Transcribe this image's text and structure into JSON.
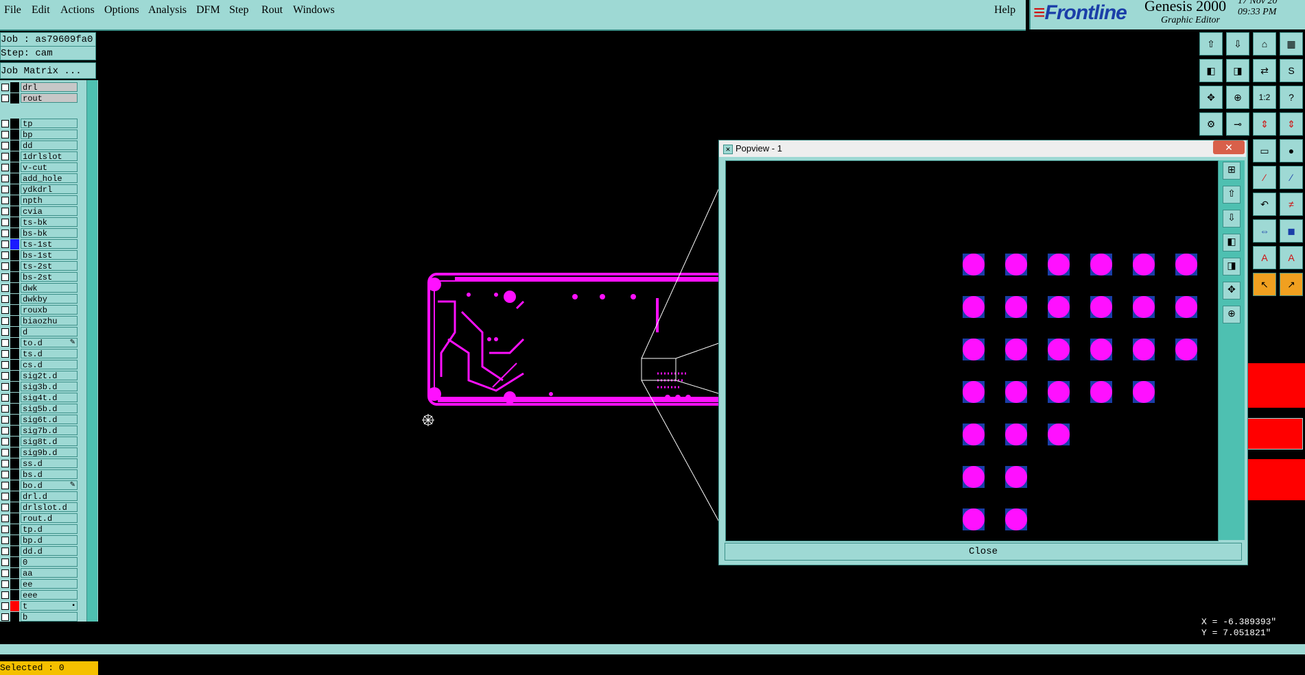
{
  "menu": {
    "items": [
      "File",
      "Edit",
      "Actions",
      "Options",
      "Analysis",
      "DFM",
      "Step",
      "Rout",
      "Windows"
    ],
    "help": "Help"
  },
  "brand": {
    "logo": "Frontline",
    "title": "Genesis 2000",
    "subtitle": "Graphic Editor",
    "date": "17 Nov 20",
    "time": "09:33 PM"
  },
  "info": {
    "job": "Job : as79609fa0",
    "step": "Step: cam",
    "matrix_button": "Job Matrix ..."
  },
  "layers": [
    {
      "name": "drl",
      "color": "#000000",
      "style": "grey"
    },
    {
      "name": "rout",
      "color": "#000000",
      "style": "grey"
    },
    {
      "name": "tp",
      "color": "#000000",
      "style": "normal"
    },
    {
      "name": "bp",
      "color": "#000000",
      "style": "normal"
    },
    {
      "name": "dd",
      "color": "#000000",
      "style": "normal"
    },
    {
      "name": "1drlslot",
      "color": "#000000",
      "style": "normal"
    },
    {
      "name": "v-cut",
      "color": "#000000",
      "style": "normal"
    },
    {
      "name": "add_hole",
      "color": "#000000",
      "style": "normal"
    },
    {
      "name": "ydkdrl",
      "color": "#000000",
      "style": "normal"
    },
    {
      "name": "npth",
      "color": "#000000",
      "style": "normal"
    },
    {
      "name": "cvia",
      "color": "#000000",
      "style": "normal"
    },
    {
      "name": "ts-bk",
      "color": "#000000",
      "style": "normal"
    },
    {
      "name": "bs-bk",
      "color": "#000000",
      "style": "normal"
    },
    {
      "name": "ts-1st",
      "color": "#1a1aff",
      "style": "normal"
    },
    {
      "name": "bs-1st",
      "color": "#000000",
      "style": "normal"
    },
    {
      "name": "ts-2st",
      "color": "#000000",
      "style": "normal"
    },
    {
      "name": "bs-2st",
      "color": "#000000",
      "style": "normal"
    },
    {
      "name": "dwk",
      "color": "#000000",
      "style": "normal"
    },
    {
      "name": "dwkby",
      "color": "#000000",
      "style": "normal"
    },
    {
      "name": "rouxb",
      "color": "#000000",
      "style": "normal"
    },
    {
      "name": "biaozhu",
      "color": "#000000",
      "style": "normal"
    },
    {
      "name": "d",
      "color": "#000000",
      "style": "normal"
    },
    {
      "name": "to.d",
      "color": "#000000",
      "style": "normal",
      "mark": "✎"
    },
    {
      "name": "ts.d",
      "color": "#000000",
      "style": "normal"
    },
    {
      "name": "cs.d",
      "color": "#000000",
      "style": "normal"
    },
    {
      "name": "sig2t.d",
      "color": "#000000",
      "style": "normal"
    },
    {
      "name": "sig3b.d",
      "color": "#000000",
      "style": "normal"
    },
    {
      "name": "sig4t.d",
      "color": "#000000",
      "style": "normal"
    },
    {
      "name": "sig5b.d",
      "color": "#000000",
      "style": "normal"
    },
    {
      "name": "sig6t.d",
      "color": "#000000",
      "style": "normal"
    },
    {
      "name": "sig7b.d",
      "color": "#000000",
      "style": "normal"
    },
    {
      "name": "sig8t.d",
      "color": "#000000",
      "style": "normal"
    },
    {
      "name": "sig9b.d",
      "color": "#000000",
      "style": "normal"
    },
    {
      "name": "ss.d",
      "color": "#000000",
      "style": "normal"
    },
    {
      "name": "bs.d",
      "color": "#000000",
      "style": "normal"
    },
    {
      "name": "bo.d",
      "color": "#000000",
      "style": "normal",
      "mark": "✎"
    },
    {
      "name": "drl.d",
      "color": "#000000",
      "style": "normal"
    },
    {
      "name": "drlslot.d",
      "color": "#000000",
      "style": "normal"
    },
    {
      "name": "rout.d",
      "color": "#000000",
      "style": "normal"
    },
    {
      "name": "tp.d",
      "color": "#000000",
      "style": "normal"
    },
    {
      "name": "bp.d",
      "color": "#000000",
      "style": "normal"
    },
    {
      "name": "dd.d",
      "color": "#000000",
      "style": "normal"
    },
    {
      "name": "0",
      "color": "#000000",
      "style": "normal"
    },
    {
      "name": "aa",
      "color": "#000000",
      "style": "normal"
    },
    {
      "name": "ee",
      "color": "#000000",
      "style": "normal"
    },
    {
      "name": "eee",
      "color": "#000000",
      "style": "normal"
    },
    {
      "name": "t",
      "color": "#ff0000",
      "style": "normal",
      "mark": "▪"
    },
    {
      "name": "b",
      "color": "#000000",
      "style": "normal"
    }
  ],
  "selected": "Selected : 0",
  "popview": {
    "title": "Popview - 1",
    "close_label": "Close",
    "pads_per_row": [
      6,
      6,
      6,
      5,
      3,
      2,
      2
    ]
  },
  "coords": {
    "x": "X = -6.389393\"",
    "y": "Y = 7.051821\""
  },
  "colors": {
    "ui": "#9ed9d4",
    "pad": "#ff10ff",
    "pad_outline": "#1a3ea8",
    "active_layer": "#ff0000"
  }
}
